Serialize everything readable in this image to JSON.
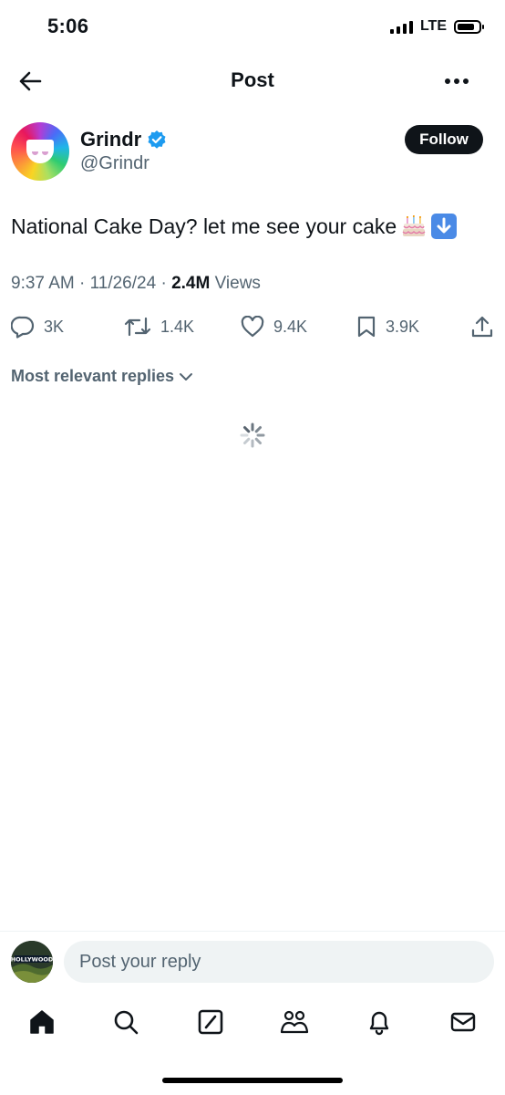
{
  "status_bar": {
    "time": "5:06",
    "network": "LTE"
  },
  "header": {
    "title": "Post"
  },
  "author": {
    "name": "Grindr",
    "handle": "@Grindr",
    "follow_label": "Follow"
  },
  "post": {
    "text": "National Cake Day? let me see your cake",
    "time": "9:37 AM",
    "date": "11/26/24",
    "views_count": "2.4M",
    "views_label": "Views"
  },
  "actions": {
    "replies": "3K",
    "reposts": "1.4K",
    "likes": "9.4K",
    "bookmarks": "3.9K"
  },
  "replies_sort": {
    "label": "Most relevant replies"
  },
  "reply_bar": {
    "placeholder": "Post your reply",
    "avatar_text": "HOLLYWOOD"
  },
  "colors": {
    "verified": "#1d9bf0",
    "text": "#0f1419",
    "muted": "#536471",
    "input_bg": "#eff3f4"
  },
  "tab_bar": [
    "home-icon",
    "search-icon",
    "grok-icon",
    "communities-icon",
    "notifications-icon",
    "messages-icon"
  ]
}
